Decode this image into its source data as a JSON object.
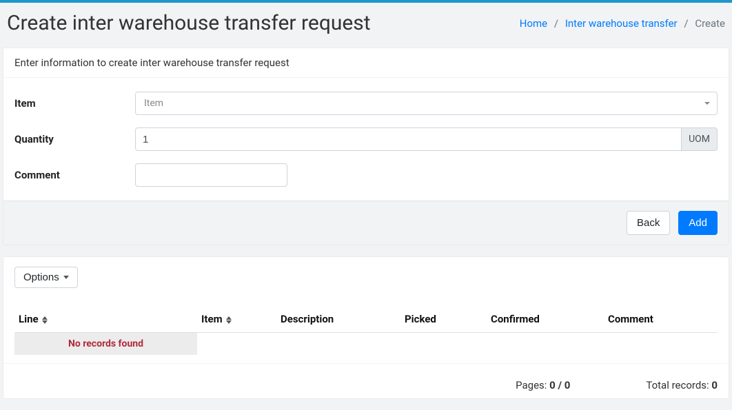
{
  "header": {
    "title": "Create inter warehouse transfer request"
  },
  "breadcrumb": {
    "home": "Home",
    "inter": "Inter warehouse transfer",
    "current": "Create"
  },
  "form": {
    "subtitle": "Enter information to create inter warehouse transfer request",
    "labels": {
      "item": "Item",
      "quantity": "Quantity",
      "comment": "Comment"
    },
    "item": {
      "placeholder": "Item",
      "value": ""
    },
    "quantity": {
      "value": "1",
      "uom_label": "UOM"
    },
    "comment": {
      "value": ""
    },
    "buttons": {
      "back": "Back",
      "add": "Add"
    }
  },
  "grid": {
    "options_label": "Options",
    "columns": {
      "line": "Line",
      "item": "Item",
      "description": "Description",
      "picked": "Picked",
      "confirmed": "Confirmed",
      "comment": "Comment"
    },
    "empty_text": "No records found",
    "footer": {
      "pages_label": "Pages: ",
      "pages_value": "0 / 0",
      "total_label": "Total records: ",
      "total_value": "0"
    }
  }
}
